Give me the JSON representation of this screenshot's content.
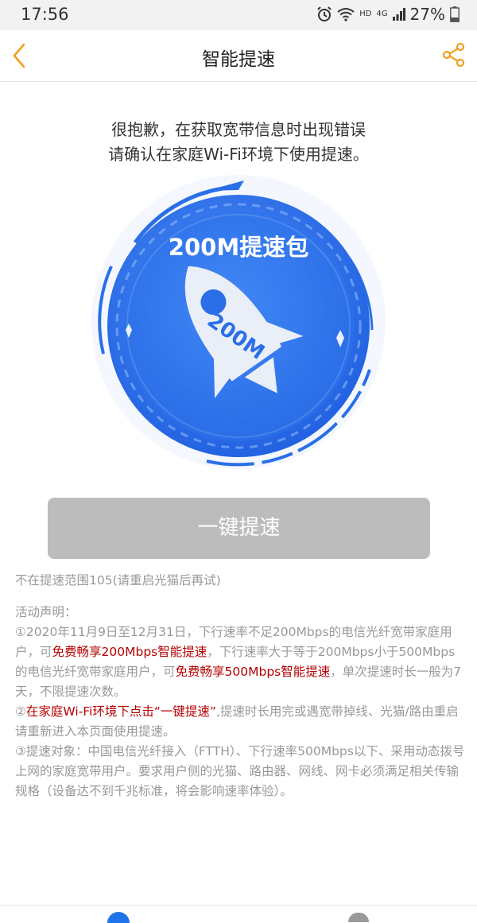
{
  "status_bar": {
    "time": "17:56",
    "hd": "HD",
    "network": "4G",
    "battery": "27%"
  },
  "nav": {
    "title": "智能提速",
    "back_icon": "chevron-left-icon",
    "share_icon": "share-icon",
    "accent_color": "#f0a020"
  },
  "error": {
    "line1": "很抱歉，在获取宽带信息时出现错误",
    "line2": "请确认在家庭Wi-Fi环境下使用提速。"
  },
  "hero": {
    "package_label": "200M提速包",
    "rocket_label": "200M",
    "color": "#2a6fe8"
  },
  "boost_button": {
    "label": "一键提速"
  },
  "hint": "不在提速范围105(请重启光猫后再试)",
  "notice": {
    "heading": "活动声明：",
    "p1_a": "①2020年11月9日至12月31日，下行速率不足200Mbps的电信光纤宽带家庭用户，可",
    "p1_b": "免费畅享200Mbps智能提速",
    "p1_c": "，下行速率大于等于200Mbps小于500Mbps的电信光纤宽带家庭用户，可",
    "p1_d": "免费畅享500Mbps智能提速",
    "p1_e": "，单次提速时长一般为7天，不限提速次数。",
    "p2_a": "②",
    "p2_b": "在家庭Wi-Fi环境下点击“一键提速”",
    "p2_c": ",提速时长用完或遇宽带掉线、光猫/路由重启请重新进入本页面使用提速。",
    "p3": "③提速对象：中国电信光纤接入（FTTH）、下行速率500Mbps以下、采用动态拨号上网的家庭宽带用户。要求用户侧的光猫、路由器、网线、网卡必须满足相关传输规格（设备达不到千兆标准，将会影响速率体验）。"
  }
}
